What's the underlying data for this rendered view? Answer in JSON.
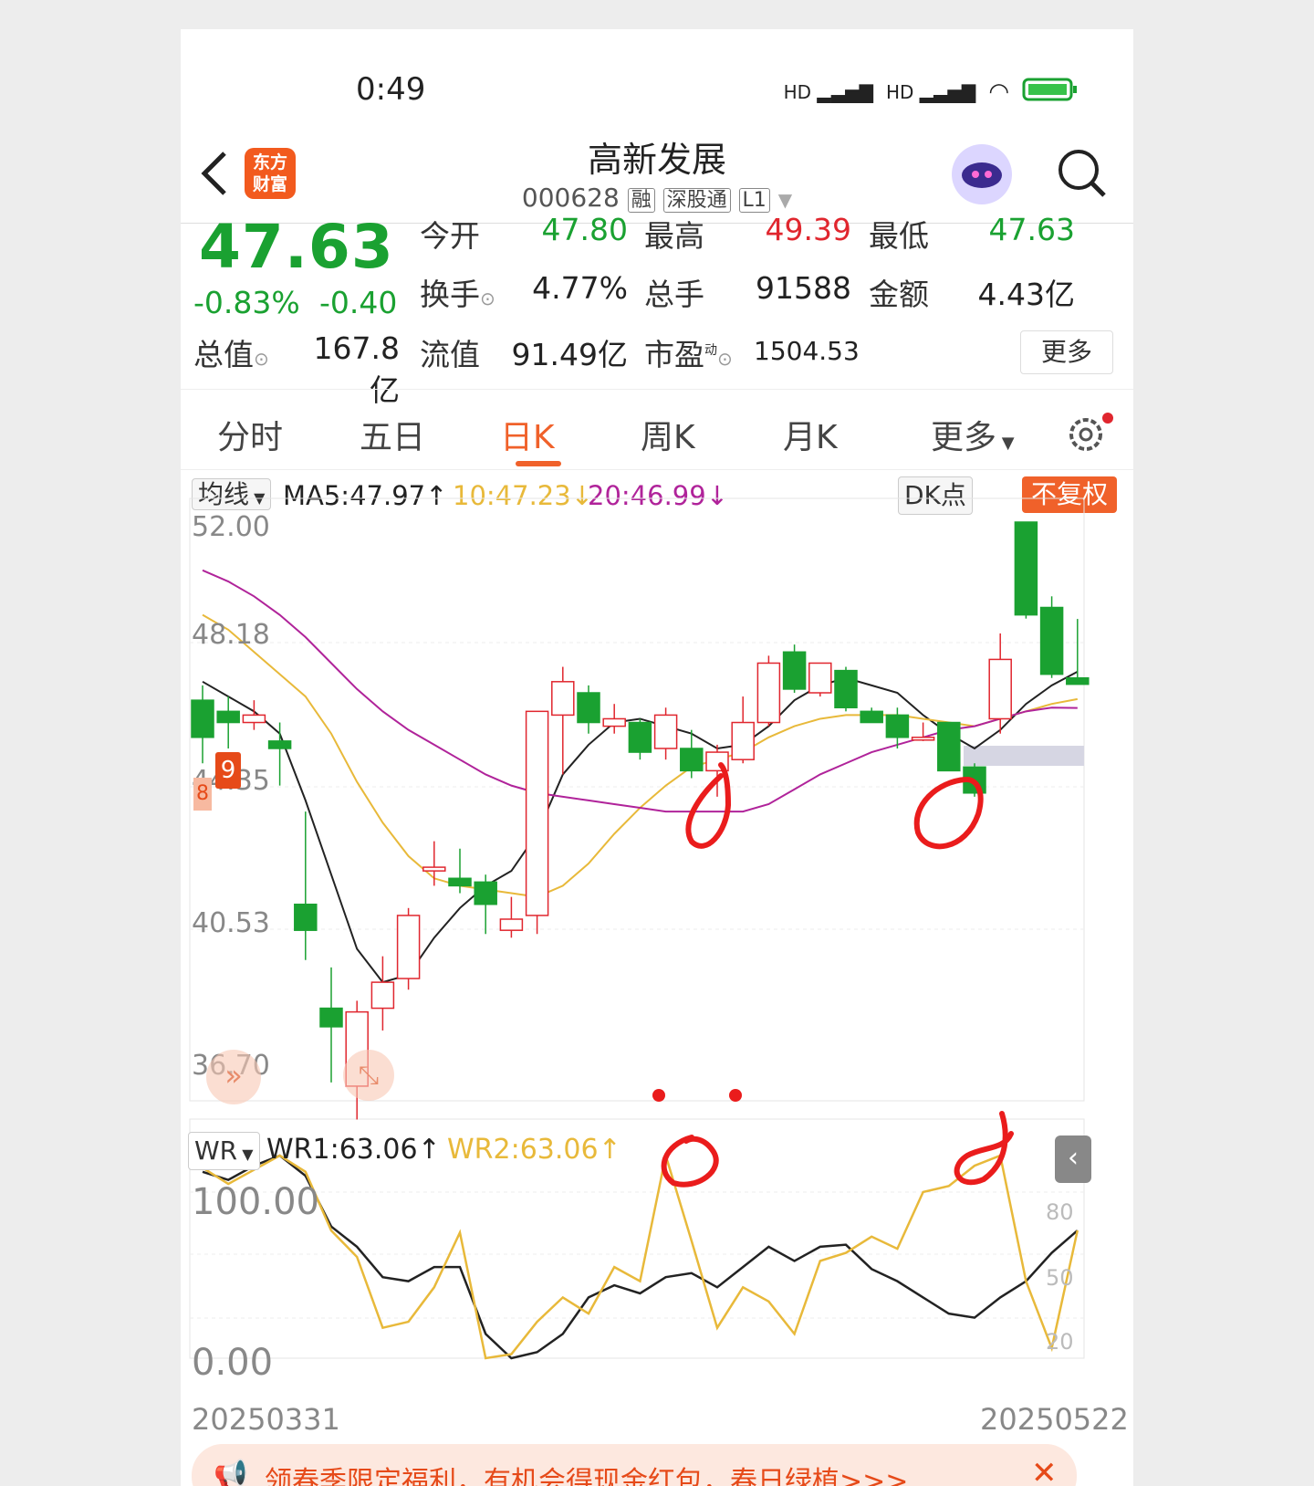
{
  "status_bar": {
    "time": "0:49",
    "signal1": "HD",
    "signal2": "HD"
  },
  "header": {
    "title": "高新发展",
    "code": "000628",
    "tags": [
      "融",
      "深股通",
      "L1"
    ],
    "logo_line1": "东方",
    "logo_line2": "财富"
  },
  "quote": {
    "price": "47.63",
    "change_pct": "-0.83%",
    "change_abs": "-0.40",
    "open_label": "今开",
    "open": "47.80",
    "high_label": "最高",
    "high": "49.39",
    "low_label": "最低",
    "low": "47.63",
    "turnover_label": "换手",
    "turnover": "4.77%",
    "volume_label": "总手",
    "volume": "91588",
    "amount_label": "金额",
    "amount": "4.43亿",
    "mktcap_label": "总值",
    "mktcap": "167.8亿",
    "float_label": "流值",
    "float": "91.49亿",
    "pe_label": "市盈",
    "pe_sup": "动",
    "pe": "1504.53",
    "more": "更多"
  },
  "tabs": [
    "分时",
    "五日",
    "日K",
    "周K",
    "月K",
    "更多"
  ],
  "ma_row": {
    "selector": "均线",
    "ma5": "MA5:47.97",
    "ma10": "10:47.23",
    "ma20": "20:46.99",
    "dk": "DK点",
    "fuquan": "不复权"
  },
  "kline_axis": [
    "52.00",
    "48.18",
    "44.35",
    "40.53",
    "36.70"
  ],
  "badges": [
    "9",
    "8"
  ],
  "wr": {
    "selector": "WR",
    "wr1": "WR1:63.06",
    "wr2": "WR2:63.06",
    "left_axis": [
      "100.00",
      "0.00"
    ],
    "right_axis": [
      "80",
      "50",
      "20"
    ]
  },
  "dates": {
    "start": "20250331",
    "end": "20250522"
  },
  "banner": {
    "text": "领春季限定福利，有机会得现金红包，春日绿植>>>"
  },
  "colors": {
    "up": "#e0262e",
    "down": "#1aa131",
    "ma5": "#222222",
    "ma10": "#e8b93a",
    "ma20": "#b0239a",
    "accent": "#f0612a"
  }
}
